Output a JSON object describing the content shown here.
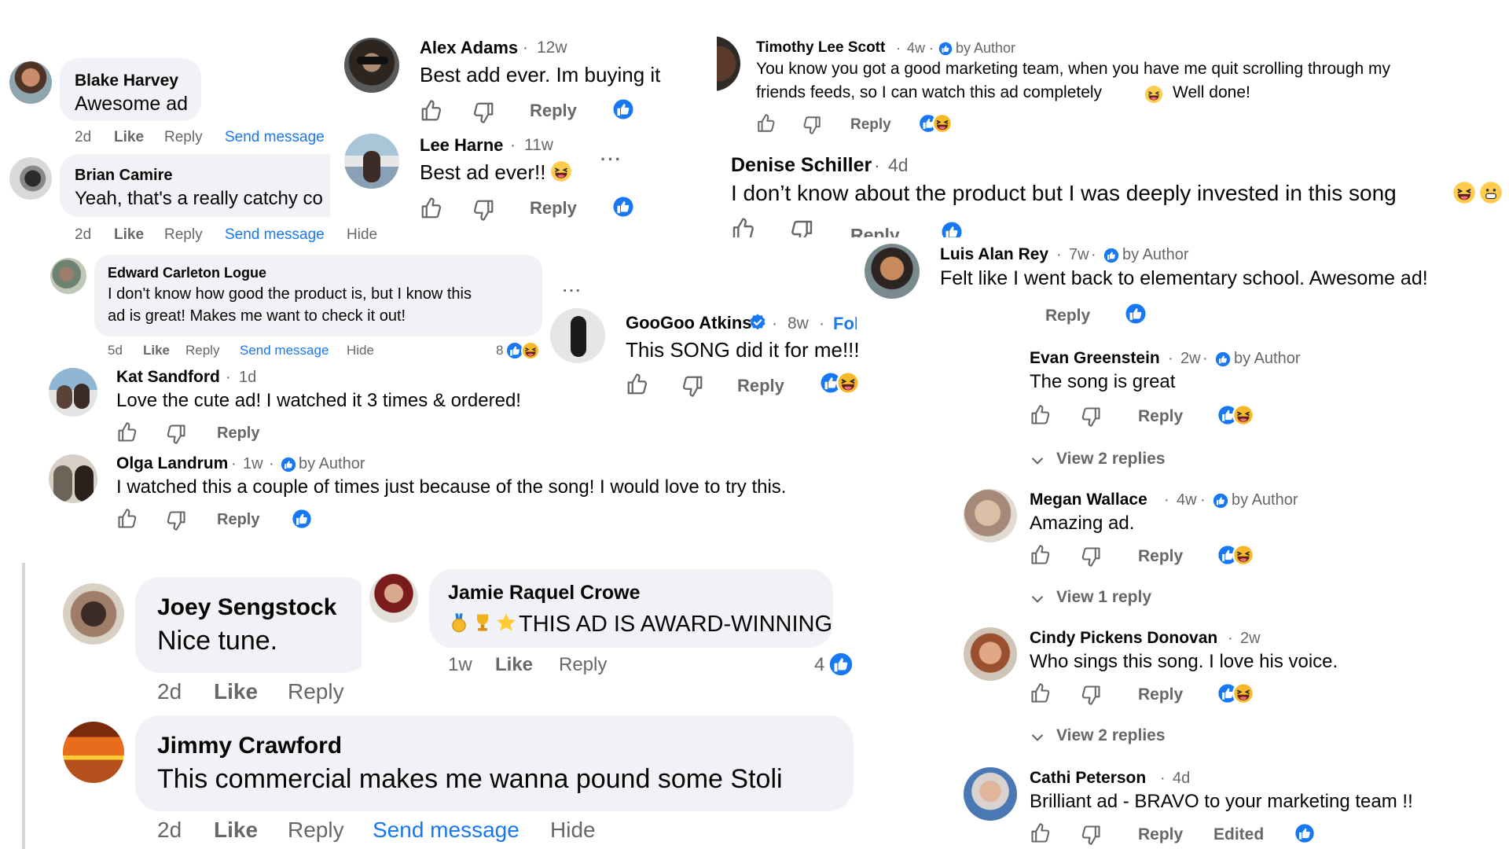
{
  "labels": {
    "like": "Like",
    "reply": "Reply",
    "send_message": "Send message",
    "hide": "Hide",
    "by_author": "by Author",
    "view_2_replies": "View 2 replies",
    "view_1_reply": "View 1 reply",
    "follow": "Follow",
    "edited": "Edited"
  },
  "colors": {
    "accent": "#1877f2",
    "bubble": "#f0f2f5",
    "meta": "#65676b",
    "text": "#050505",
    "haha": "#f7b928"
  },
  "icons": [
    "thumbs-up-icon",
    "thumbs-down-icon",
    "like-reaction-icon",
    "haha-reaction-icon",
    "verified-badge-icon",
    "author-badge-icon",
    "more-options-icon",
    "chevron-down-icon"
  ],
  "comments": {
    "blake": {
      "name": "Blake Harvey",
      "text": "Awesome ad",
      "time": "2d"
    },
    "brian": {
      "name": "Brian Camire",
      "text": "Yeah, that's a really catchy co",
      "time": "2d"
    },
    "alex": {
      "name": "Alex Adams",
      "time": "12w",
      "text": "Best add ever. Im buying it"
    },
    "lee": {
      "name": "Lee Harne",
      "time": "11w",
      "text": "Best ad ever!!"
    },
    "edward": {
      "name": "Edward Carleton Logue",
      "text1": "I don't know how good the product is, but I know this",
      "text2": "ad is great! Makes me want to check it out!",
      "time": "5d",
      "reactions": "8"
    },
    "kat": {
      "name": "Kat Sandford",
      "time": "1d",
      "text": "Love the cute ad! I watched it 3 times & ordered!"
    },
    "olga": {
      "name": "Olga Landrum",
      "time": "1w",
      "text": "I watched this a couple of times just because of the song! I would love to try this."
    },
    "goo": {
      "name": "GooGoo Atkins",
      "time": "8w",
      "text": "This SONG did it for me!!!"
    },
    "timothy": {
      "name": "Timothy Lee Scott",
      "time": "4w",
      "text1": "You know you got a good marketing team, when you have me quit scrolling through my",
      "text2": "friends feeds, so I can watch this ad completely",
      "text3": "Well done!"
    },
    "denise": {
      "name": "Denise Schiller",
      "time": "4d",
      "text": "I don’t know about the product but I was deeply invested in this song"
    },
    "luis": {
      "name": "Luis Alan Rey",
      "time": "7w",
      "text": "Felt like I went back to elementary school. Awesome ad!"
    },
    "evan": {
      "name": "Evan Greenstein",
      "time": "2w",
      "text": "The song is great"
    },
    "megan": {
      "name": "Megan Wallace",
      "time": "4w",
      "text": "Amazing ad."
    },
    "cindy": {
      "name": "Cindy Pickens Donovan",
      "time": "2w",
      "text": "Who sings this song. I love his voice."
    },
    "cathi": {
      "name": "Cathi Peterson",
      "time": "4d",
      "text": "Brilliant ad - BRAVO to your marketing team !!"
    },
    "joey": {
      "name": "Joey Sengstock",
      "text": "Nice tune.",
      "time": "2d"
    },
    "jamie": {
      "name": "Jamie Raquel Crowe",
      "text": "THIS AD IS AWARD-WINNING",
      "time": "1w",
      "reactions": "4"
    },
    "jimmy": {
      "name": "Jimmy Crawford",
      "text": "This commercial makes me wanna pound some Stoli",
      "time": "2d"
    }
  }
}
